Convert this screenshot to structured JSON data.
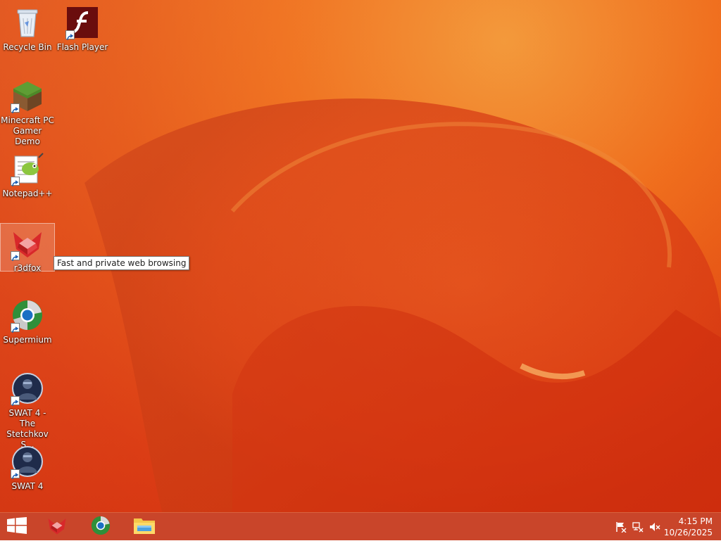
{
  "desktop": {
    "icons": [
      {
        "label": "Recycle Bin",
        "icon": "recycle-bin-icon"
      },
      {
        "label": "Flash Player",
        "icon": "flash-player-icon"
      },
      {
        "label": "Minecraft PC Gamer Demo",
        "icon": "minecraft-icon"
      },
      {
        "label": "Notepad++",
        "icon": "notepad-plus-plus-icon"
      },
      {
        "label": "r3dfox",
        "icon": "r3dfox-icon",
        "selected": true
      },
      {
        "label": "Supermium",
        "icon": "supermium-icon"
      },
      {
        "label": "SWAT 4 - The Stetchkov S...",
        "icon": "swat4-icon"
      },
      {
        "label": "SWAT 4",
        "icon": "swat4-icon"
      }
    ],
    "tooltip": "Fast and private web browsing"
  },
  "taskbar": {
    "start": "windows-start-icon",
    "pinned": [
      "r3dfox-icon",
      "supermium-icon",
      "file-explorer-icon"
    ],
    "tray": [
      "action-center-flag-icon",
      "network-icon",
      "volume-muted-icon"
    ],
    "clock": {
      "time": "4:15 PM",
      "date": "10/26/2025"
    }
  },
  "colors": {
    "wallpaper_primary": "#e24a12",
    "wallpaper_highlight": "#f39a3a",
    "taskbar": "#c9452a"
  }
}
